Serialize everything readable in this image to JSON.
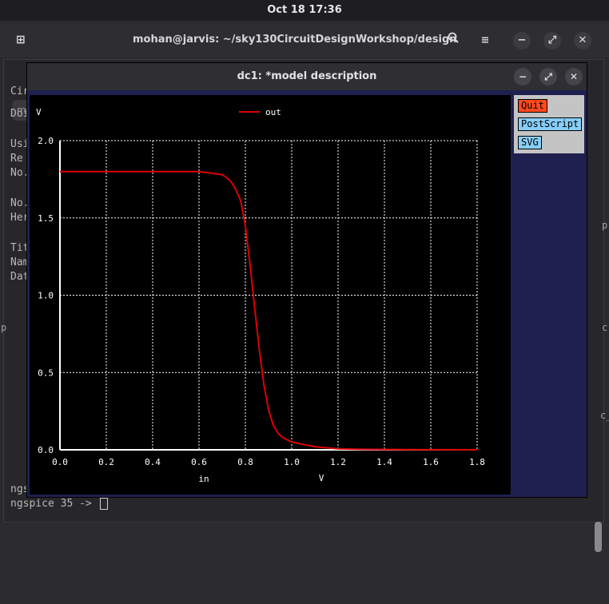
{
  "system": {
    "clock": "Oct 18  17:36"
  },
  "terminal": {
    "title": "mohan@jarvis: ~/sky130CircuitDesignWorkshop/design",
    "tab_stub": "m",
    "lines": [
      "Cir",
      "Doi",
      "Usi",
      " Re",
      "No.",
      "No.",
      "Her",
      "Tit",
      "Nam",
      "Dat"
    ],
    "right_edge": [
      "p",
      "c",
      "c_"
    ],
    "left_edge": [
      "p"
    ],
    "bottom_lines": [
      "ngs",
      "ngspice 35 -> "
    ]
  },
  "plot_window": {
    "title": "dc1: *model description",
    "buttons": {
      "quit": "Quit",
      "postscript": "PostScript",
      "svg": "SVG"
    }
  },
  "icons": {
    "search": "search-icon",
    "menu": "hamburger-menu-icon",
    "minimize": "minimize-icon",
    "maximize": "maximize-icon",
    "close": "close-icon",
    "new_tab": "new-tab-icon"
  },
  "chart_data": {
    "type": "line",
    "title": "",
    "xlabel": "in",
    "xunit": "V",
    "ylabel": "V",
    "xlim": [
      0,
      1.8
    ],
    "ylim": [
      0,
      2.0
    ],
    "x_ticks": [
      "0.0",
      "0.2",
      "0.4",
      "0.6",
      "0.8",
      "1.0",
      "1.2",
      "1.4",
      "1.6",
      "1.8"
    ],
    "y_ticks": [
      "0.0",
      "0.5",
      "1.0",
      "1.5",
      "2.0"
    ],
    "grid": true,
    "legend_position": "top-center",
    "series": [
      {
        "name": "out",
        "color": "#dd0000",
        "x": [
          0.0,
          0.2,
          0.4,
          0.6,
          0.65,
          0.7,
          0.72,
          0.74,
          0.76,
          0.78,
          0.8,
          0.82,
          0.84,
          0.86,
          0.88,
          0.9,
          0.92,
          0.94,
          0.96,
          1.0,
          1.05,
          1.1,
          1.2,
          1.3,
          1.5,
          1.8
        ],
        "y": [
          1.8,
          1.8,
          1.8,
          1.8,
          1.79,
          1.78,
          1.76,
          1.73,
          1.68,
          1.61,
          1.45,
          1.2,
          0.92,
          0.65,
          0.42,
          0.26,
          0.16,
          0.11,
          0.08,
          0.05,
          0.035,
          0.02,
          0.006,
          0.003,
          0.001,
          0.0
        ]
      }
    ]
  },
  "colors": {
    "plot_bg": "#000000",
    "panel_bg": "#1f2050",
    "quit_bg": "#ff4a1c",
    "button_bg": "#87cefa",
    "trace": "#dd0000"
  }
}
